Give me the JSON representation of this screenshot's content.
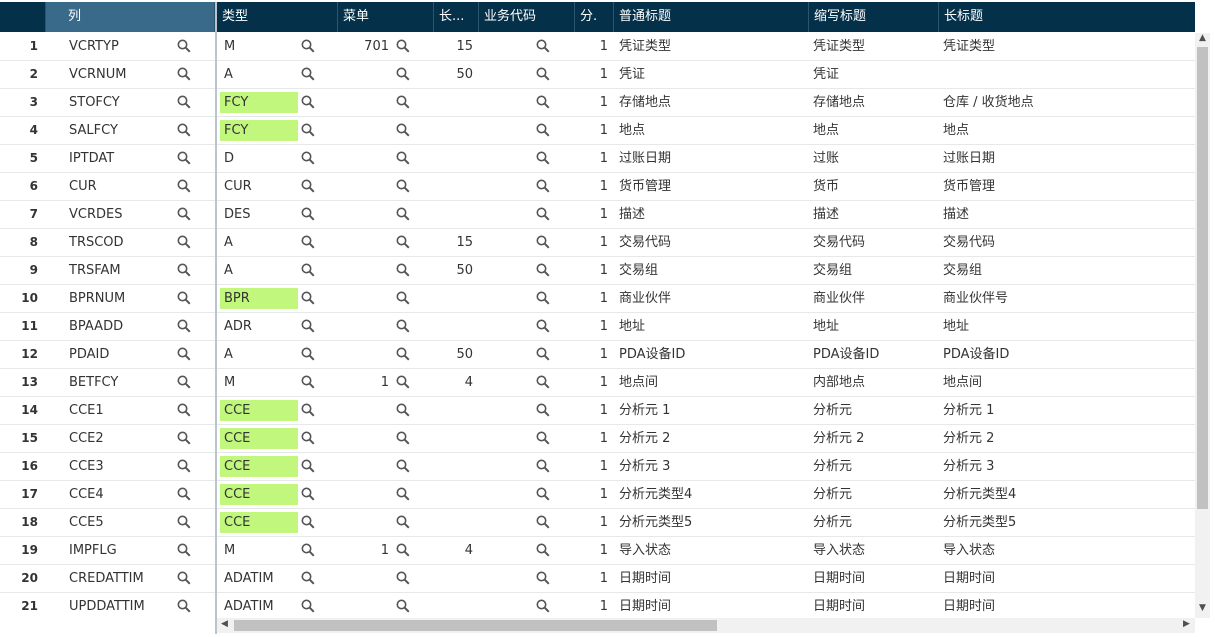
{
  "headers": [
    "列",
    "类型",
    "菜单",
    "长...",
    "业务代码",
    "分.",
    "普通标题",
    "缩写标题",
    "长标题"
  ],
  "rows": [
    {
      "n": "1",
      "col": "VCRTYP",
      "type": "M",
      "hl": false,
      "menu": "701",
      "len": "15",
      "biz": "",
      "div": "1",
      "title": "凭证类型",
      "short": "凭证类型",
      "long": "凭证类型"
    },
    {
      "n": "2",
      "col": "VCRNUM",
      "type": "A",
      "hl": false,
      "menu": "",
      "len": "50",
      "biz": "",
      "div": "1",
      "title": "凭证",
      "short": "凭证",
      "long": ""
    },
    {
      "n": "3",
      "col": "STOFCY",
      "type": "FCY",
      "hl": true,
      "menu": "",
      "len": "",
      "biz": "",
      "div": "1",
      "title": "存储地点",
      "short": "存储地点",
      "long": "仓库 / 收货地点"
    },
    {
      "n": "4",
      "col": "SALFCY",
      "type": "FCY",
      "hl": true,
      "menu": "",
      "len": "",
      "biz": "",
      "div": "1",
      "title": "地点",
      "short": "地点",
      "long": "地点"
    },
    {
      "n": "5",
      "col": "IPTDAT",
      "type": "D",
      "hl": false,
      "menu": "",
      "len": "",
      "biz": "",
      "div": "1",
      "title": "过账日期",
      "short": "过账",
      "long": "过账日期"
    },
    {
      "n": "6",
      "col": "CUR",
      "type": "CUR",
      "hl": false,
      "menu": "",
      "len": "",
      "biz": "",
      "div": "1",
      "title": "货币管理",
      "short": "货币",
      "long": "货币管理"
    },
    {
      "n": "7",
      "col": "VCRDES",
      "type": "DES",
      "hl": false,
      "menu": "",
      "len": "",
      "biz": "",
      "div": "1",
      "title": "描述",
      "short": "描述",
      "long": "描述"
    },
    {
      "n": "8",
      "col": "TRSCOD",
      "type": "A",
      "hl": false,
      "menu": "",
      "len": "15",
      "biz": "",
      "div": "1",
      "title": "交易代码",
      "short": "交易代码",
      "long": "交易代码"
    },
    {
      "n": "9",
      "col": "TRSFAM",
      "type": "A",
      "hl": false,
      "menu": "",
      "len": "50",
      "biz": "",
      "div": "1",
      "title": "交易组",
      "short": "交易组",
      "long": "交易组"
    },
    {
      "n": "10",
      "col": "BPRNUM",
      "type": "BPR",
      "hl": true,
      "menu": "",
      "len": "",
      "biz": "",
      "div": "1",
      "title": "商业伙伴",
      "short": "商业伙伴",
      "long": "商业伙伴号"
    },
    {
      "n": "11",
      "col": "BPAADD",
      "type": "ADR",
      "hl": false,
      "menu": "",
      "len": "",
      "biz": "",
      "div": "1",
      "title": "地址",
      "short": "地址",
      "long": "地址"
    },
    {
      "n": "12",
      "col": "PDAID",
      "type": "A",
      "hl": false,
      "menu": "",
      "len": "50",
      "biz": "",
      "div": "1",
      "title": "PDA设备ID",
      "short": "PDA设备ID",
      "long": "PDA设备ID"
    },
    {
      "n": "13",
      "col": "BETFCY",
      "type": "M",
      "hl": false,
      "menu": "1",
      "len": "4",
      "biz": "",
      "div": "1",
      "title": "地点间",
      "short": "内部地点",
      "long": "地点间"
    },
    {
      "n": "14",
      "col": "CCE1",
      "type": "CCE",
      "hl": true,
      "menu": "",
      "len": "",
      "biz": "",
      "div": "1",
      "title": "分析元 1",
      "short": "分析元",
      "long": "分析元 1"
    },
    {
      "n": "15",
      "col": "CCE2",
      "type": "CCE",
      "hl": true,
      "menu": "",
      "len": "",
      "biz": "",
      "div": "1",
      "title": "分析元 2",
      "short": "分析元 2",
      "long": "分析元 2"
    },
    {
      "n": "16",
      "col": "CCE3",
      "type": "CCE",
      "hl": true,
      "menu": "",
      "len": "",
      "biz": "",
      "div": "1",
      "title": "分析元 3",
      "short": "分析元",
      "long": "分析元 3"
    },
    {
      "n": "17",
      "col": "CCE4",
      "type": "CCE",
      "hl": true,
      "menu": "",
      "len": "",
      "biz": "",
      "div": "1",
      "title": "分析元类型4",
      "short": "分析元",
      "long": "分析元类型4"
    },
    {
      "n": "18",
      "col": "CCE5",
      "type": "CCE",
      "hl": true,
      "menu": "",
      "len": "",
      "biz": "",
      "div": "1",
      "title": "分析元类型5",
      "short": "分析元",
      "long": "分析元类型5"
    },
    {
      "n": "19",
      "col": "IMPFLG",
      "type": "M",
      "hl": false,
      "menu": "1",
      "len": "4",
      "biz": "",
      "div": "1",
      "title": "导入状态",
      "short": "导入状态",
      "long": "导入状态"
    },
    {
      "n": "20",
      "col": "CREDATTIM",
      "type": "ADATIM",
      "hl": false,
      "menu": "",
      "len": "",
      "biz": "",
      "div": "1",
      "title": "日期时间",
      "short": "日期时间",
      "long": "日期时间"
    },
    {
      "n": "21",
      "col": "UPDDATTIM",
      "type": "ADATIM",
      "hl": false,
      "menu": "",
      "len": "",
      "biz": "",
      "div": "1",
      "title": "日期时间",
      "short": "日期时间",
      "long": "日期时间"
    }
  ],
  "icons": {
    "kebab": "kebab-icon",
    "search": "search-icon"
  },
  "colors": {
    "header_bg": "#04304a",
    "highlight": "#c2f77e",
    "header_selected": "#3a6a8a"
  }
}
